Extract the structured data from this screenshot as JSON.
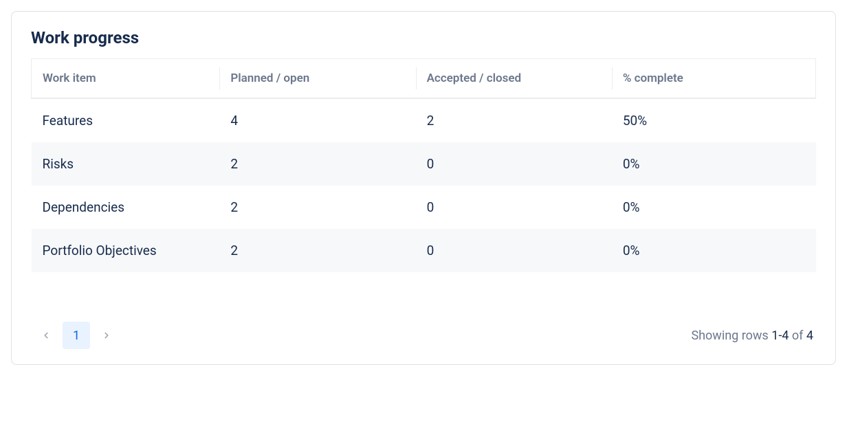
{
  "card": {
    "title": "Work progress"
  },
  "table": {
    "headers": {
      "work_item": "Work item",
      "planned_open": "Planned / open",
      "accepted_closed": "Accepted / closed",
      "pct_complete": "% complete"
    },
    "rows": [
      {
        "work_item": "Features",
        "planned_open": "4",
        "accepted_closed": "2",
        "pct_complete": "50%"
      },
      {
        "work_item": "Risks",
        "planned_open": "2",
        "accepted_closed": "0",
        "pct_complete": "0%"
      },
      {
        "work_item": "Dependencies",
        "planned_open": "2",
        "accepted_closed": "0",
        "pct_complete": "0%"
      },
      {
        "work_item": "Portfolio Objectives",
        "planned_open": "2",
        "accepted_closed": "0",
        "pct_complete": "0%"
      }
    ]
  },
  "pagination": {
    "current_page": "1",
    "rows_label": "Showing rows ",
    "rows_range": "1-4",
    "rows_of": " of ",
    "rows_total": "4"
  }
}
